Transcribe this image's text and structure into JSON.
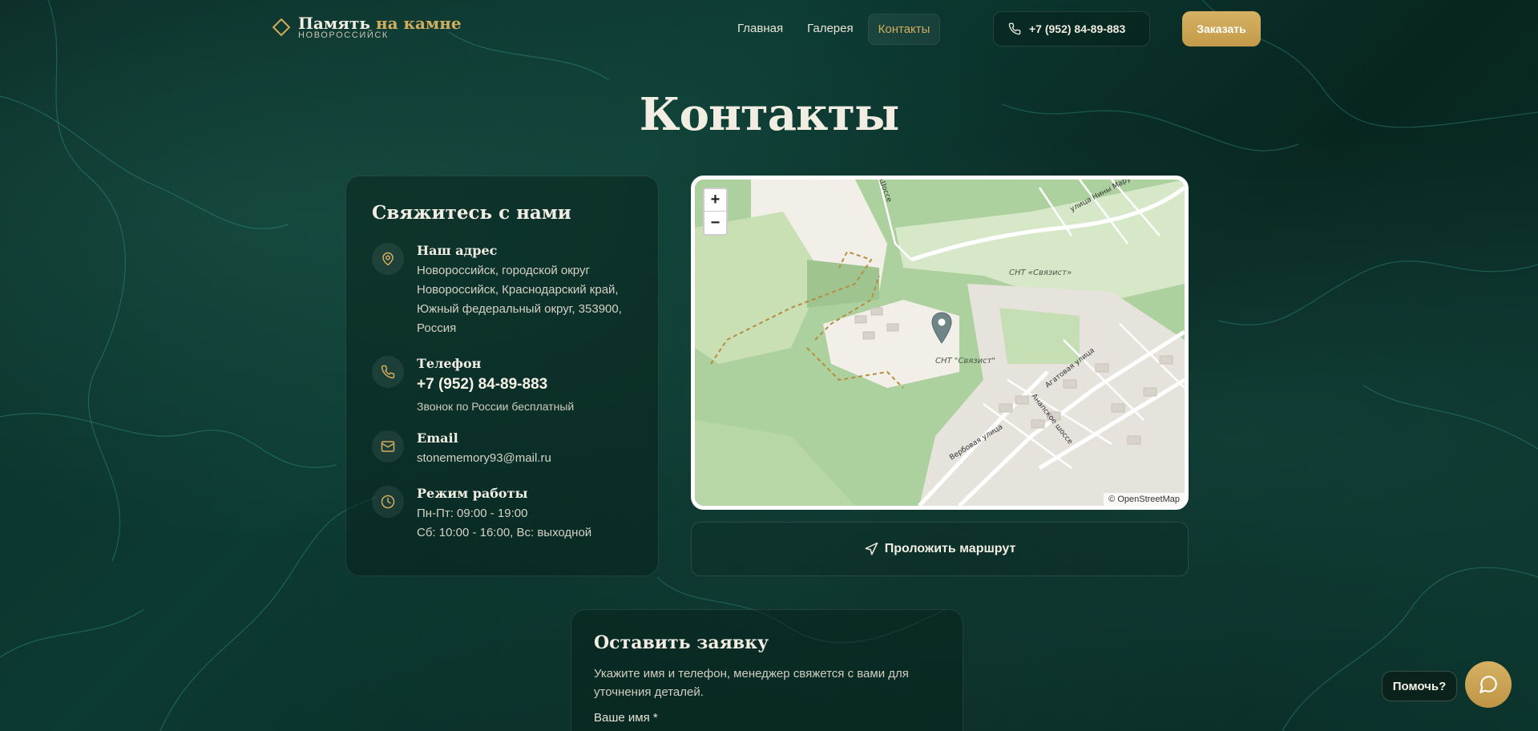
{
  "header": {
    "logo_title_main": "Память",
    "logo_title_accent": "на камне",
    "logo_subtitle": "НОВОРОССИЙСК",
    "nav": [
      {
        "label": "Главная",
        "active": false
      },
      {
        "label": "Галерея",
        "active": false
      },
      {
        "label": "Контакты",
        "active": true
      }
    ],
    "phone": "+7 (952) 84-89-883",
    "order_label": "Заказать"
  },
  "page": {
    "title": "Контакты"
  },
  "contact_card": {
    "title": "Свяжитесь с нами",
    "address": {
      "title": "Наш адрес",
      "text": "Новороссийск, городской округ Новороссийск, Краснодарский край, Южный федеральный округ, 353900, Россия",
      "icon": "map-pin-icon"
    },
    "phone": {
      "title": "Телефон",
      "number": "+7 (952) 84-89-883",
      "note": "Звонок по России бесплатный",
      "icon": "phone-icon"
    },
    "email": {
      "title": "Email",
      "text": "stonememory93@mail.ru",
      "icon": "mail-icon"
    },
    "hours": {
      "title": "Режим работы",
      "line1": "Пн-Пт: 09:00 - 19:00",
      "line2": "Сб: 10:00 - 16:00, Вс: выходной",
      "icon": "clock-icon"
    }
  },
  "map": {
    "zoom_in": "+",
    "zoom_out": "−",
    "attribution": "© OpenStreetMap",
    "labels": [
      "СНТ «Связист»",
      "СНТ \"Связист\"",
      "улица Нины Марухно",
      "Агатовая улица",
      "Анапское шоссе",
      "Вербовая улица",
      "Шоссе"
    ]
  },
  "route_label": "Проложить маршрут",
  "form": {
    "title": "Оставить заявку",
    "description": "Укажите имя и телефон, менеджер свяжется с вами для уточнения деталей.",
    "name_label": "Ваше имя *"
  },
  "help_label": "Помочь?",
  "colors": {
    "accent": "#d3ad5e",
    "background": "#0b3530",
    "text": "#f1ede3"
  }
}
